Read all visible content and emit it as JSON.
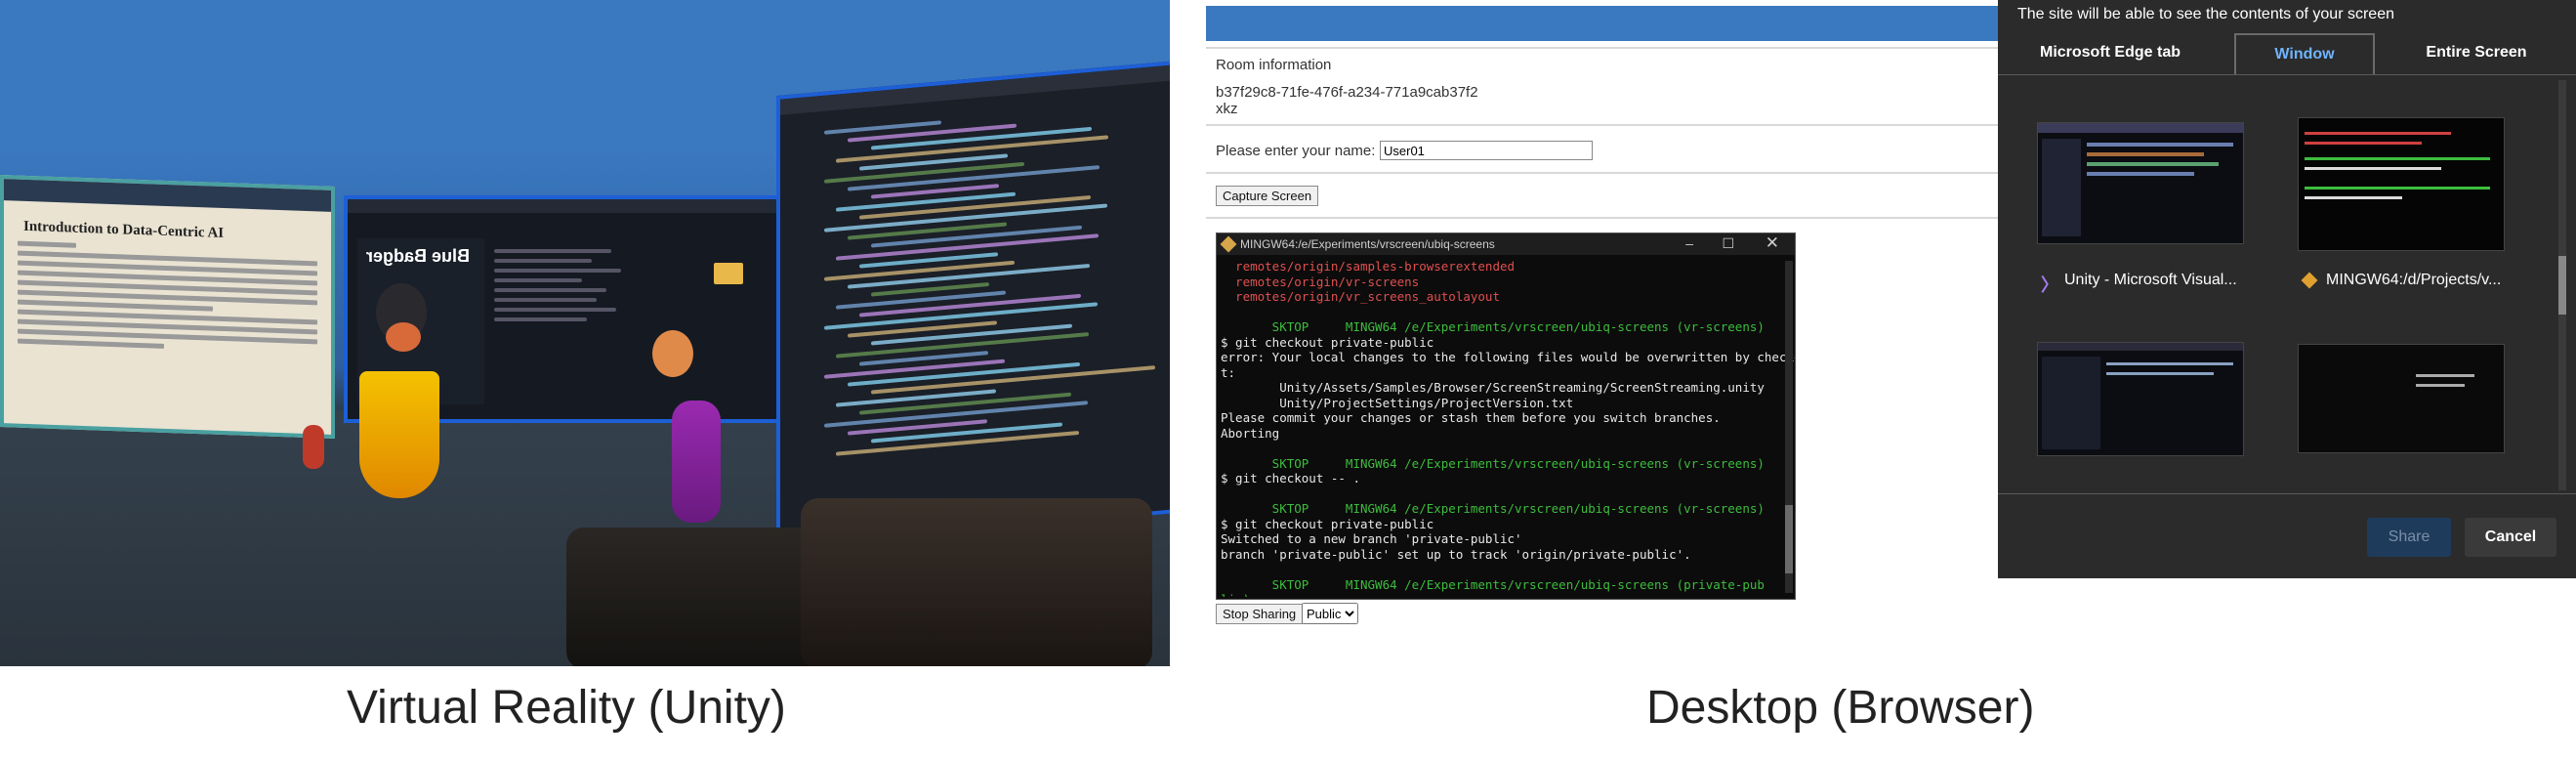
{
  "captions": {
    "left": "Virtual Reality (Unity)",
    "right": "Desktop (Browser)"
  },
  "vr": {
    "doc_title": "Introduction to Data-Centric AI",
    "avatar_name": "Blue Badger",
    "colors": {
      "sky": "#3a78c0",
      "screen_border": "#1d5fd6",
      "avatar_yellow": "#f0b000",
      "avatar_purple": "#8a2aa0"
    }
  },
  "desktop": {
    "room_info_label": "Room information",
    "room_id": "b37f29c8-71fe-476f-a234-771a9cab37f2",
    "room_code": "xkz",
    "name_prompt": "Please enter your name:",
    "name_value": "User01",
    "capture_button": "Capture Screen",
    "stop_sharing_button": "Stop Sharing",
    "visibility_select": "Public",
    "terminal": {
      "title": "MINGW64:/e/Experiments/vrscreen/ubiq-screens",
      "lines": [
        {
          "text": "  remotes/origin/samples-browserextended",
          "color": "#e05050"
        },
        {
          "text": "  remotes/origin/vr-screens",
          "color": "#e05050"
        },
        {
          "text": "  remotes/origin/vr_screens_autolayout",
          "color": "#e05050"
        },
        {
          "text": "",
          "color": "#ddd"
        },
        {
          "text": "       SKTOP     MINGW64 /e/Experiments/vrscreen/ubiq-screens (vr-screens)",
          "color": "#3dbd3d"
        },
        {
          "text": "$ git checkout private-public",
          "color": "#e8e8e8"
        },
        {
          "text": "error: Your local changes to the following files would be overwritten by checkou",
          "color": "#e8e8e8"
        },
        {
          "text": "t:",
          "color": "#e8e8e8"
        },
        {
          "text": "        Unity/Assets/Samples/Browser/ScreenStreaming/ScreenStreaming.unity",
          "color": "#e8e8e8"
        },
        {
          "text": "        Unity/ProjectSettings/ProjectVersion.txt",
          "color": "#e8e8e8"
        },
        {
          "text": "Please commit your changes or stash them before you switch branches.",
          "color": "#e8e8e8"
        },
        {
          "text": "Aborting",
          "color": "#e8e8e8"
        },
        {
          "text": "",
          "color": "#ddd"
        },
        {
          "text": "       SKTOP     MINGW64 /e/Experiments/vrscreen/ubiq-screens (vr-screens)",
          "color": "#3dbd3d"
        },
        {
          "text": "$ git checkout -- .",
          "color": "#e8e8e8"
        },
        {
          "text": "",
          "color": "#ddd"
        },
        {
          "text": "       SKTOP     MINGW64 /e/Experiments/vrscreen/ubiq-screens (vr-screens)",
          "color": "#3dbd3d"
        },
        {
          "text": "$ git checkout private-public",
          "color": "#e8e8e8"
        },
        {
          "text": "Switched to a new branch 'private-public'",
          "color": "#e8e8e8"
        },
        {
          "text": "branch 'private-public' set up to track 'origin/private-public'.",
          "color": "#e8e8e8"
        },
        {
          "text": "",
          "color": "#ddd"
        },
        {
          "text": "       SKTOP     MINGW64 /e/Experiments/vrscreen/ubiq-screens (private-pub",
          "color": "#3dbd3d"
        },
        {
          "text": "lic)",
          "color": "#3dbd3d"
        },
        {
          "text": "$",
          "color": "#e8e8e8"
        }
      ]
    },
    "dialog": {
      "header": "The site will be able to see the contents of your screen",
      "tabs": [
        "Microsoft Edge tab",
        "Window",
        "Entire Screen"
      ],
      "active_tab": "Window",
      "windows": [
        {
          "label": "Unity - Microsoft Visual..."
        },
        {
          "label": "MINGW64:/d/Projects/v..."
        },
        {
          "label": ""
        },
        {
          "label": ""
        }
      ],
      "share_button": "Share",
      "cancel_button": "Cancel"
    }
  }
}
